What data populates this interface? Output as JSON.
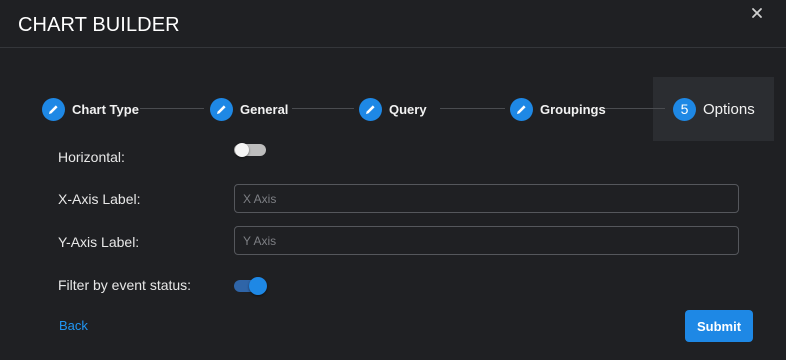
{
  "dialog": {
    "title": "CHART BUILDER",
    "close_icon": "close-icon"
  },
  "stepper": {
    "steps": [
      {
        "label": "Chart Type",
        "state": "completed",
        "icon": "pencil-icon"
      },
      {
        "label": "General",
        "state": "completed",
        "icon": "pencil-icon"
      },
      {
        "label": "Query",
        "state": "completed",
        "icon": "pencil-icon"
      },
      {
        "label": "Groupings",
        "state": "completed",
        "icon": "pencil-icon"
      },
      {
        "label": "Options",
        "state": "active",
        "number": "5"
      }
    ]
  },
  "form": {
    "horizontal": {
      "label": "Horizontal:",
      "checked": false
    },
    "x_axis": {
      "label": "X-Axis Label:",
      "value": "",
      "placeholder": "X Axis"
    },
    "y_axis": {
      "label": "Y-Axis Label:",
      "value": "",
      "placeholder": "Y Axis"
    },
    "filter_status": {
      "label": "Filter by event status:",
      "checked": true
    }
  },
  "footer": {
    "back_label": "Back",
    "submit_label": "Submit"
  },
  "colors": {
    "background": "#1f2023",
    "accent": "#1e88e5",
    "text": "#e8e8e8"
  }
}
